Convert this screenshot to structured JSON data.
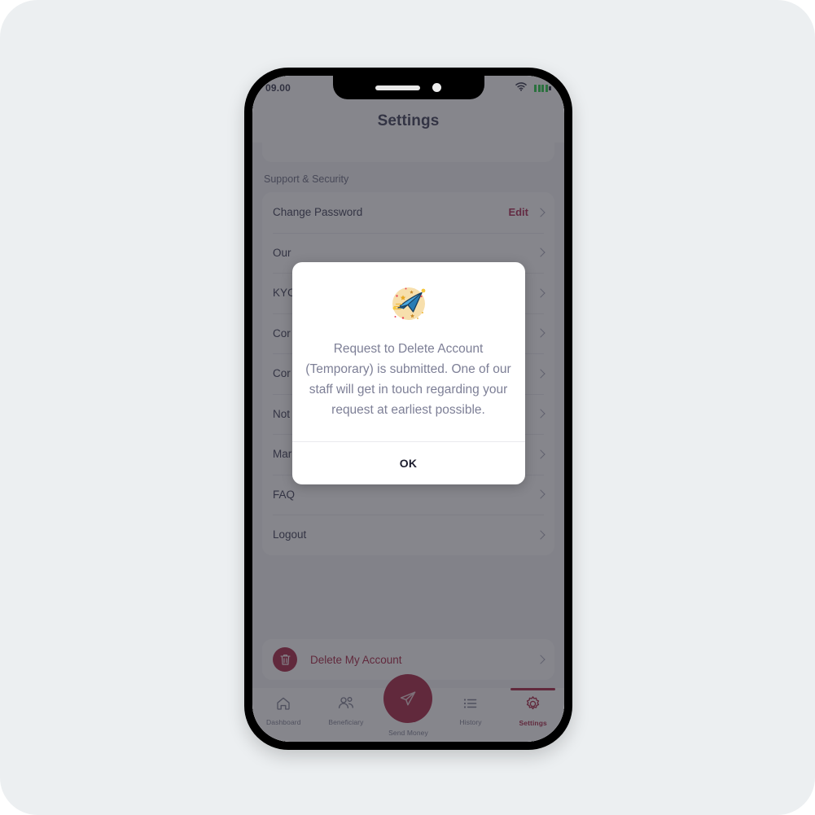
{
  "theme": {
    "page_background": "#eceff1",
    "brand_red": "#9e0b2f",
    "accent_red": "#a4123f",
    "text_dark": "#272842",
    "text_muted": "#7d7f96",
    "battery_green": "#12c933",
    "illustration_circle": "#f7dfac",
    "illustration_plane": "#3c9bd6"
  },
  "status_bar": {
    "time": "09.00",
    "wifi_icon": "wifi-icon",
    "battery_icon": "battery-icon"
  },
  "header": {
    "title": "Settings"
  },
  "settings": {
    "section_title": "Support & Security",
    "rows": [
      {
        "label": "Change Password",
        "action": "Edit",
        "has_chevron": true
      },
      {
        "label": "Our",
        "action": "",
        "has_chevron": true
      },
      {
        "label": "KYC",
        "action": "",
        "has_chevron": true
      },
      {
        "label": "Cor",
        "action": "",
        "has_chevron": true
      },
      {
        "label": "Cor",
        "action": "",
        "has_chevron": true
      },
      {
        "label": "Not",
        "action": "",
        "has_chevron": true
      },
      {
        "label": "Mar",
        "action": "",
        "has_chevron": true
      },
      {
        "label": "FAQ",
        "action": "",
        "has_chevron": true
      },
      {
        "label": "Logout",
        "action": "",
        "has_chevron": true
      }
    ]
  },
  "delete_account": {
    "label": "Delete My Account",
    "icon": "trash-icon",
    "chevron": "chevron-right-icon"
  },
  "bottom_nav": {
    "items": [
      {
        "label": "Dashboard",
        "icon": "home-icon",
        "active": false
      },
      {
        "label": "Beneficiary",
        "icon": "users-icon",
        "active": false
      },
      {
        "label": "History",
        "icon": "list-icon",
        "active": false
      },
      {
        "label": "Settings",
        "icon": "gear-icon",
        "active": true
      }
    ],
    "fab": {
      "label": "Send Money",
      "icon": "paper-plane-icon"
    }
  },
  "dialog": {
    "illustration": "paper-plane-illustration",
    "message": "Request to Delete Account (Temporary) is submitted. One of our staff will get in touch regarding your request at earliest possible.",
    "ok_label": "OK"
  }
}
